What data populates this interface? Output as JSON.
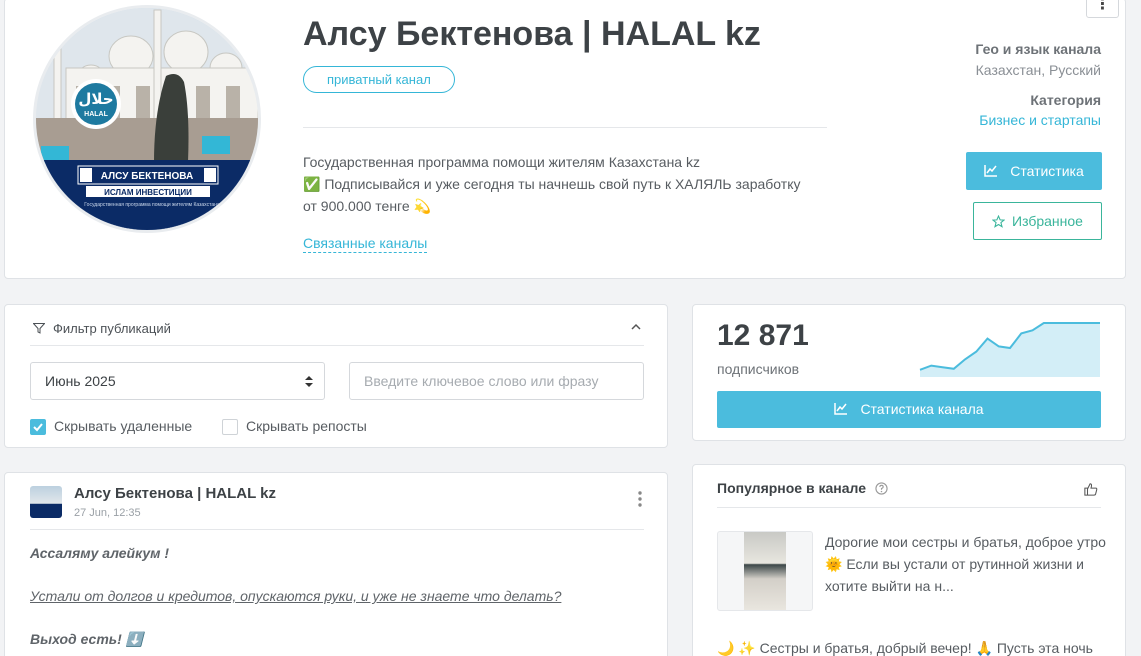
{
  "channel": {
    "title": "Алсу Бектенова | HALAL kz",
    "badge": "приватный канал",
    "description_line1": "Государственная программа помощи жителям Казахстана kz",
    "description_line2": "✅ Подписывайся и уже сегодня ты начнешь свой путь к ХАЛЯЛЬ заработку",
    "description_line3": "от 900.000 тенге 💫",
    "related_link": "Связанные каналы",
    "geo_label": "Гео и язык канала",
    "geo_value": "Казахстан, Русский",
    "category_label": "Категория",
    "category_value": "Бизнес и стартапы",
    "stats_button": "Статистика",
    "favorite_button": "Избранное",
    "more_icon": "⋮",
    "avatar_text": {
      "logo": "حلال",
      "logo_sub": "HALAL",
      "name": "АЛСУ БЕКТЕНОВА",
      "tagline": "ИСЛАМ ИНВЕСТИЦИИ",
      "footer": "Государственная программа помощи жителям Казахстана"
    }
  },
  "filter": {
    "title": "Фильтр публикаций",
    "month_value": "Июнь 2025",
    "keyword_placeholder": "Введите ключевое слово или фразу",
    "hide_deleted_label": "Скрывать удаленные",
    "hide_deleted_checked": true,
    "hide_reposts_label": "Скрывать репосты",
    "hide_reposts_checked": false
  },
  "subscribers": {
    "count": "12 871",
    "label": "подписчиков",
    "button": "Статистика канала",
    "trend": [
      0.1,
      0.18,
      0.15,
      0.12,
      0.3,
      0.45,
      0.7,
      0.55,
      0.52,
      0.8,
      0.86,
      1.0,
      1.0,
      1.0,
      1.0,
      1.0,
      1.0
    ]
  },
  "post": {
    "author": "Алсу Бектенова | HALAL kz",
    "date": "27 Jun, 12:35",
    "line1": "Ассаляму алейкум !",
    "line2": "Устали от долгов и кредитов, опускаются руки, и уже не знаете что делать?",
    "line3": "Выход есть! ⬇️"
  },
  "popular": {
    "title": "Популярное в канале",
    "item1_text": "Дорогие мои сестры и братья, доброе утро 🌞 Если вы устали от рутинной жизни и хотите выйти на н...",
    "item2_text": "🌙 ✨ Сестры и братья, добрый вечер! 🙏 Пусть эта ночь"
  },
  "colors": {
    "accent": "#4bbcdd",
    "favorite": "#3ab59b",
    "text_dark": "#3d4246"
  }
}
